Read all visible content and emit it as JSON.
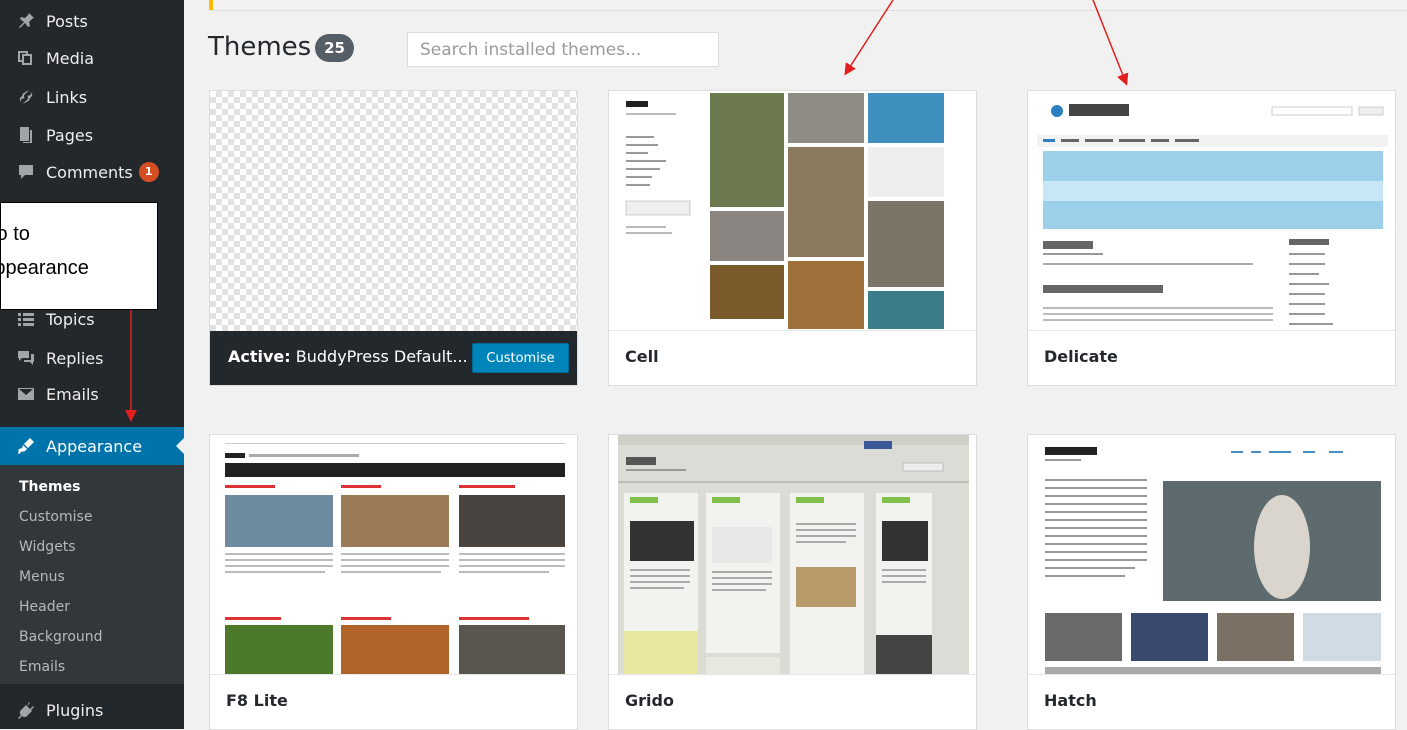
{
  "sidebar": {
    "items": [
      {
        "label": "Posts",
        "icon": "pin-icon"
      },
      {
        "label": "Media",
        "icon": "media-icon"
      },
      {
        "label": "Links",
        "icon": "link-icon"
      },
      {
        "label": "Pages",
        "icon": "pages-icon"
      },
      {
        "label": "Comments",
        "icon": "comment-icon",
        "badge": "1"
      },
      {
        "label": "Topics",
        "icon": "topics-icon"
      },
      {
        "label": "Replies",
        "icon": "replies-icon"
      },
      {
        "label": "Emails",
        "icon": "mail-icon"
      },
      {
        "label": "Appearance",
        "icon": "brush-icon",
        "active": true
      },
      {
        "label": "Plugins",
        "icon": "plugin-icon"
      }
    ],
    "submenu": [
      "Themes",
      "Customise",
      "Widgets",
      "Menus",
      "Header",
      "Background",
      "Emails"
    ],
    "current_submenu": "Themes"
  },
  "header": {
    "title": "Themes",
    "count": "25",
    "search_placeholder": "Search installed themes..."
  },
  "themes": [
    {
      "name": "BuddyPress Default...",
      "active_prefix": "Active:",
      "button": "Customise"
    },
    {
      "name": "Cell"
    },
    {
      "name": "Delicate"
    },
    {
      "name": "F8 Lite"
    },
    {
      "name": "Grido"
    },
    {
      "name": "Hatch"
    }
  ],
  "callout": {
    "line1": "Go to",
    "line2": "Appearance"
  },
  "colors": {
    "sidebar": "#23282d",
    "active": "#0073aa",
    "annotation": "#e0201e",
    "button": "#0085ba"
  }
}
